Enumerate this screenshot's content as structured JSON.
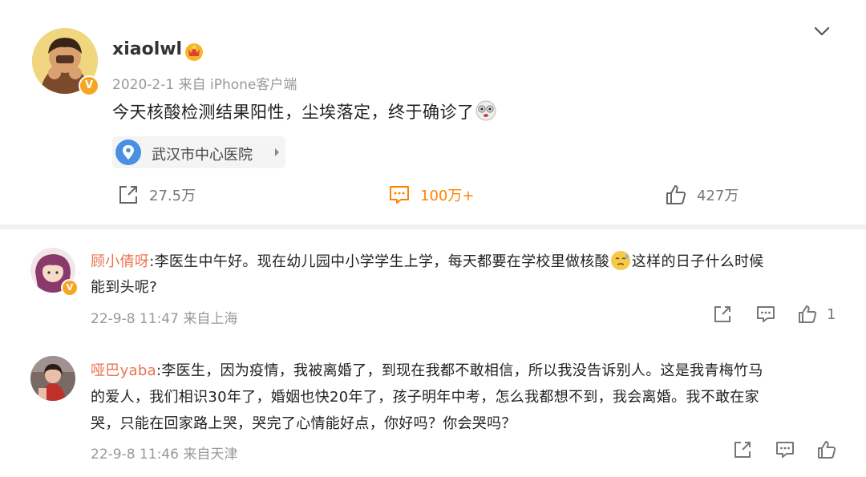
{
  "post": {
    "username": "xiaolwl",
    "meta": "2020-2-1 来自 iPhone客户端",
    "text": "今天核酸检测结果阳性，尘埃落定，终于确诊了",
    "location": "武汉市中心医院",
    "share_count": "27.5万",
    "comment_count": "100万+",
    "like_count": "427万",
    "verified_badge": "V"
  },
  "comments": [
    {
      "name": "顾小倩呀",
      "line1_a": ":李医生中午好。现在幼儿园中小学学生上学，每天都要在学校里做核酸",
      "line1_b": "这样的日子什么时候",
      "line2": "能到头呢?",
      "meta": "22-9-8 11:47 来自上海",
      "like_count": "1",
      "verified_badge": "V"
    },
    {
      "name": "哑巴yaba",
      "line1": ":李医生，因为疫情，我被离婚了，到现在我都不敢相信，所以我没告诉别人。这是我青梅竹马",
      "line2": "的爱人，我们相识30年了，婚姻也快20年了，孩子明年中考，怎么我都想不到，我会离婚。我不敢在家",
      "line3": "哭，只能在回家路上哭，哭完了心情能好点，你好吗？你会哭吗？",
      "meta": "22-9-8 11:46 来自天津"
    }
  ],
  "colors": {
    "accent_orange": "#ff8200",
    "name_color": "#eb7350",
    "location_blue": "#4a90e2",
    "meta_gray": "#999999"
  },
  "icons": [
    "chevron-down-icon",
    "crown-icon",
    "location-icon",
    "share-icon",
    "comment-icon",
    "like-icon",
    "stars-eyes-emoji",
    "sweat-emoji"
  ]
}
